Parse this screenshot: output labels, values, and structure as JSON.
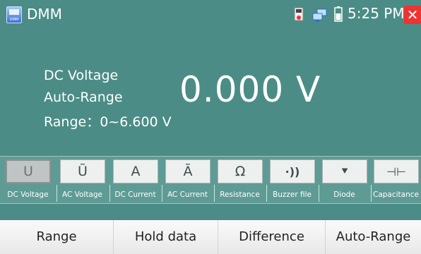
{
  "titlebar": {
    "app_icon_label": "DMM",
    "title": "DMM",
    "clock": "5:25 PM",
    "close_glyph": "✕",
    "icons": [
      "dmm-app-icon",
      "sd-card-icon",
      "network-icon",
      "battery-icon",
      "close-icon"
    ],
    "close_color": "#e33333"
  },
  "readout": {
    "mode": "DC Voltage",
    "range_mode": "Auto-Range",
    "range": "Range：0~6.600 V",
    "value": "0.000 V"
  },
  "modes": [
    {
      "symbol": "U",
      "label": "DC Voltage",
      "active": true
    },
    {
      "symbol": "Ũ",
      "label": "AC Voltage",
      "active": false
    },
    {
      "symbol": "A",
      "label": "DC Current",
      "active": false
    },
    {
      "symbol": "Ã",
      "label": "AC Current",
      "active": false
    },
    {
      "symbol": "Ω",
      "label": "Resistance",
      "active": false
    },
    {
      "symbol": "·))",
      "label": "Buzzer file",
      "active": false
    },
    {
      "symbol": "⯆",
      "label": "Diode",
      "active": false
    },
    {
      "symbol": "⊣⊢",
      "label": "Capacitance",
      "active": false
    }
  ],
  "footer": {
    "range": "Range",
    "hold": "Hold data",
    "difference": "Difference",
    "auto_range": "Auto-Range"
  },
  "colors": {
    "background": "#4b8c86",
    "accent": "#e33333"
  }
}
